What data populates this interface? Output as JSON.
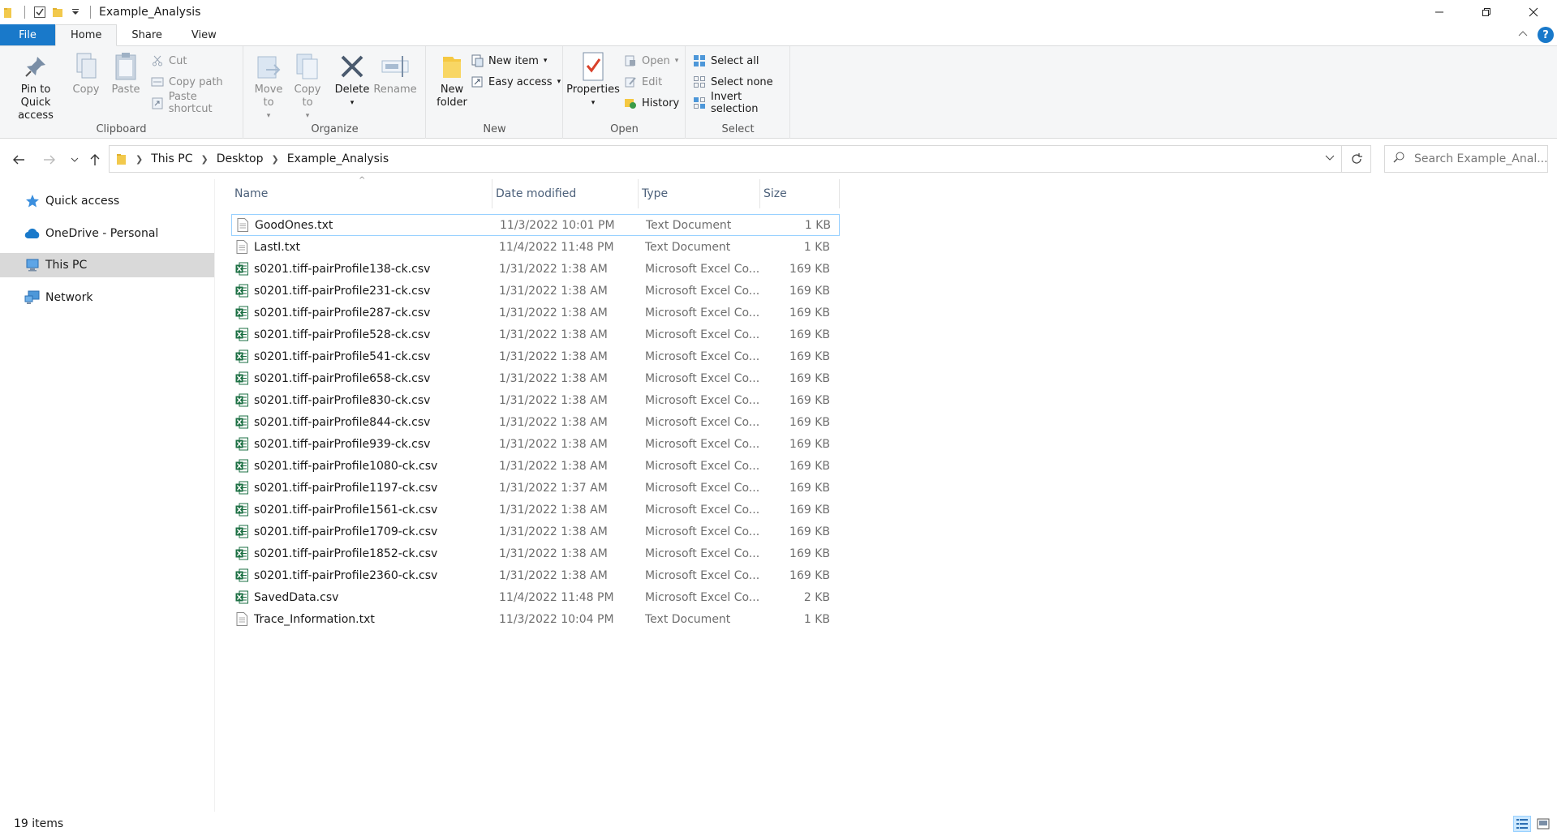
{
  "window": {
    "title": "Example_Analysis"
  },
  "tabs": [
    {
      "label": "File"
    },
    {
      "label": "Home"
    },
    {
      "label": "Share"
    },
    {
      "label": "View"
    }
  ],
  "ribbon": {
    "clipboard": {
      "pin_label": "Pin to Quick access",
      "copy_label": "Copy",
      "paste_label": "Paste",
      "cut_label": "Cut",
      "copy_path_label": "Copy path",
      "paste_shortcut_label": "Paste shortcut",
      "group_label": "Clipboard"
    },
    "organize": {
      "move_to_label": "Move to",
      "copy_to_label": "Copy to",
      "delete_label": "Delete",
      "rename_label": "Rename",
      "group_label": "Organize"
    },
    "new": {
      "new_folder_label": "New folder",
      "new_item_label": "New item",
      "easy_access_label": "Easy access",
      "group_label": "New"
    },
    "open": {
      "properties_label": "Properties",
      "open_label": "Open",
      "edit_label": "Edit",
      "history_label": "History",
      "group_label": "Open"
    },
    "select": {
      "select_all_label": "Select all",
      "select_none_label": "Select none",
      "invert_selection_label": "Invert selection",
      "group_label": "Select"
    }
  },
  "address": {
    "crumbs": [
      "This PC",
      "Desktop",
      "Example_Analysis"
    ],
    "search_placeholder": "Search Example_Anal..."
  },
  "nav_pane": {
    "items": [
      {
        "label": "Quick access",
        "icon": "star-icon"
      },
      {
        "label": "OneDrive - Personal",
        "icon": "cloud-icon"
      },
      {
        "label": "This PC",
        "icon": "computer-icon",
        "selected": true
      },
      {
        "label": "Network",
        "icon": "network-icon"
      }
    ]
  },
  "file_list": {
    "columns": [
      "Name",
      "Date modified",
      "Type",
      "Size"
    ],
    "rows": [
      {
        "name": "GoodOnes.txt",
        "date": "11/3/2022 10:01 PM",
        "type": "Text Document",
        "size": "1 KB",
        "icon": "text"
      },
      {
        "name": "LastI.txt",
        "date": "11/4/2022 11:48 PM",
        "type": "Text Document",
        "size": "1 KB",
        "icon": "text"
      },
      {
        "name": "s0201.tiff-pairProfile138-ck.csv",
        "date": "1/31/2022 1:38 AM",
        "type": "Microsoft Excel Co...",
        "size": "169 KB",
        "icon": "excel"
      },
      {
        "name": "s0201.tiff-pairProfile231-ck.csv",
        "date": "1/31/2022 1:38 AM",
        "type": "Microsoft Excel Co...",
        "size": "169 KB",
        "icon": "excel"
      },
      {
        "name": "s0201.tiff-pairProfile287-ck.csv",
        "date": "1/31/2022 1:38 AM",
        "type": "Microsoft Excel Co...",
        "size": "169 KB",
        "icon": "excel"
      },
      {
        "name": "s0201.tiff-pairProfile528-ck.csv",
        "date": "1/31/2022 1:38 AM",
        "type": "Microsoft Excel Co...",
        "size": "169 KB",
        "icon": "excel"
      },
      {
        "name": "s0201.tiff-pairProfile541-ck.csv",
        "date": "1/31/2022 1:38 AM",
        "type": "Microsoft Excel Co...",
        "size": "169 KB",
        "icon": "excel"
      },
      {
        "name": "s0201.tiff-pairProfile658-ck.csv",
        "date": "1/31/2022 1:38 AM",
        "type": "Microsoft Excel Co...",
        "size": "169 KB",
        "icon": "excel"
      },
      {
        "name": "s0201.tiff-pairProfile830-ck.csv",
        "date": "1/31/2022 1:38 AM",
        "type": "Microsoft Excel Co...",
        "size": "169 KB",
        "icon": "excel"
      },
      {
        "name": "s0201.tiff-pairProfile844-ck.csv",
        "date": "1/31/2022 1:38 AM",
        "type": "Microsoft Excel Co...",
        "size": "169 KB",
        "icon": "excel"
      },
      {
        "name": "s0201.tiff-pairProfile939-ck.csv",
        "date": "1/31/2022 1:38 AM",
        "type": "Microsoft Excel Co...",
        "size": "169 KB",
        "icon": "excel"
      },
      {
        "name": "s0201.tiff-pairProfile1080-ck.csv",
        "date": "1/31/2022 1:38 AM",
        "type": "Microsoft Excel Co...",
        "size": "169 KB",
        "icon": "excel"
      },
      {
        "name": "s0201.tiff-pairProfile1197-ck.csv",
        "date": "1/31/2022 1:37 AM",
        "type": "Microsoft Excel Co...",
        "size": "169 KB",
        "icon": "excel"
      },
      {
        "name": "s0201.tiff-pairProfile1561-ck.csv",
        "date": "1/31/2022 1:38 AM",
        "type": "Microsoft Excel Co...",
        "size": "169 KB",
        "icon": "excel"
      },
      {
        "name": "s0201.tiff-pairProfile1709-ck.csv",
        "date": "1/31/2022 1:38 AM",
        "type": "Microsoft Excel Co...",
        "size": "169 KB",
        "icon": "excel"
      },
      {
        "name": "s0201.tiff-pairProfile1852-ck.csv",
        "date": "1/31/2022 1:38 AM",
        "type": "Microsoft Excel Co...",
        "size": "169 KB",
        "icon": "excel"
      },
      {
        "name": "s0201.tiff-pairProfile2360-ck.csv",
        "date": "1/31/2022 1:38 AM",
        "type": "Microsoft Excel Co...",
        "size": "169 KB",
        "icon": "excel"
      },
      {
        "name": "SavedData.csv",
        "date": "11/4/2022 11:48 PM",
        "type": "Microsoft Excel Co...",
        "size": "2 KB",
        "icon": "excel"
      },
      {
        "name": "Trace_Information.txt",
        "date": "11/3/2022 10:04 PM",
        "type": "Text Document",
        "size": "1 KB",
        "icon": "text"
      }
    ]
  },
  "status": {
    "item_count": "19 items"
  },
  "colors": {
    "accent": "#1979ca",
    "selection_border": "#99d1ff",
    "excel_green": "#1d7044"
  }
}
